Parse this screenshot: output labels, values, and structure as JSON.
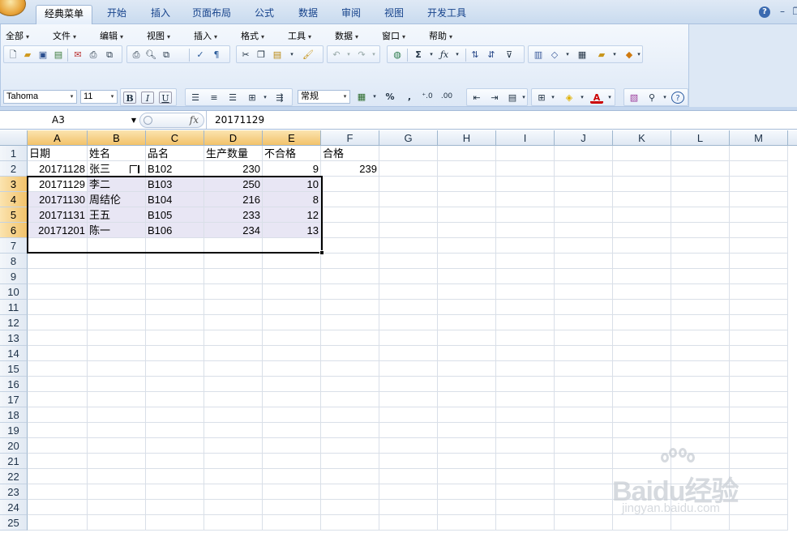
{
  "tabs": [
    "经典菜单",
    "开始",
    "插入",
    "页面布局",
    "公式",
    "数据",
    "审阅",
    "视图",
    "开发工具"
  ],
  "active_tab": "经典菜单",
  "menu": [
    "全部",
    "文件",
    "编辑",
    "视图",
    "插入",
    "格式",
    "工具",
    "数据",
    "窗口",
    "帮助"
  ],
  "format_bar": {
    "font_name": "Tahoma",
    "font_size": "11",
    "number_format": "常规",
    "bold": "B",
    "italic": "I",
    "underline": "U",
    "percent": "%",
    "comma": ","
  },
  "name_box": "A3",
  "fx_symbol": "fx",
  "formula_value": "20171129",
  "columns": [
    "A",
    "B",
    "C",
    "D",
    "E",
    "F",
    "G",
    "H",
    "I",
    "J",
    "K",
    "L",
    "M"
  ],
  "selected_columns": [
    "A",
    "B",
    "C",
    "D",
    "E"
  ],
  "rows": [
    "1",
    "2",
    "3",
    "4",
    "5",
    "6",
    "7",
    "8",
    "9",
    "10",
    "11",
    "12",
    "13",
    "14",
    "15",
    "16",
    "17",
    "18",
    "19",
    "20",
    "21",
    "22",
    "23",
    "24",
    "25"
  ],
  "selected_rows": [
    "3",
    "4",
    "5",
    "6"
  ],
  "headers": [
    "日期",
    "姓名",
    "品名",
    "生产数量",
    "不合格",
    "合格"
  ],
  "data_rows": [
    [
      "20171128",
      "张三",
      "B102",
      "230",
      "9",
      "239"
    ],
    [
      "20171129",
      "李二",
      "B103",
      "250",
      "10",
      ""
    ],
    [
      "20171130",
      "周结伦",
      "B104",
      "216",
      "8",
      ""
    ],
    [
      "20171131",
      "王五",
      "B105",
      "233",
      "12",
      ""
    ],
    [
      "20171201",
      "陈一",
      "B106",
      "234",
      "13",
      ""
    ]
  ],
  "watermark": {
    "line1": "Baidu经验",
    "line2": "jingyan.baidu.com"
  },
  "colors": {
    "selection_header": "#f2c26a",
    "selection_fill": "#e8e6f4",
    "ribbon": "#dde8f6"
  }
}
